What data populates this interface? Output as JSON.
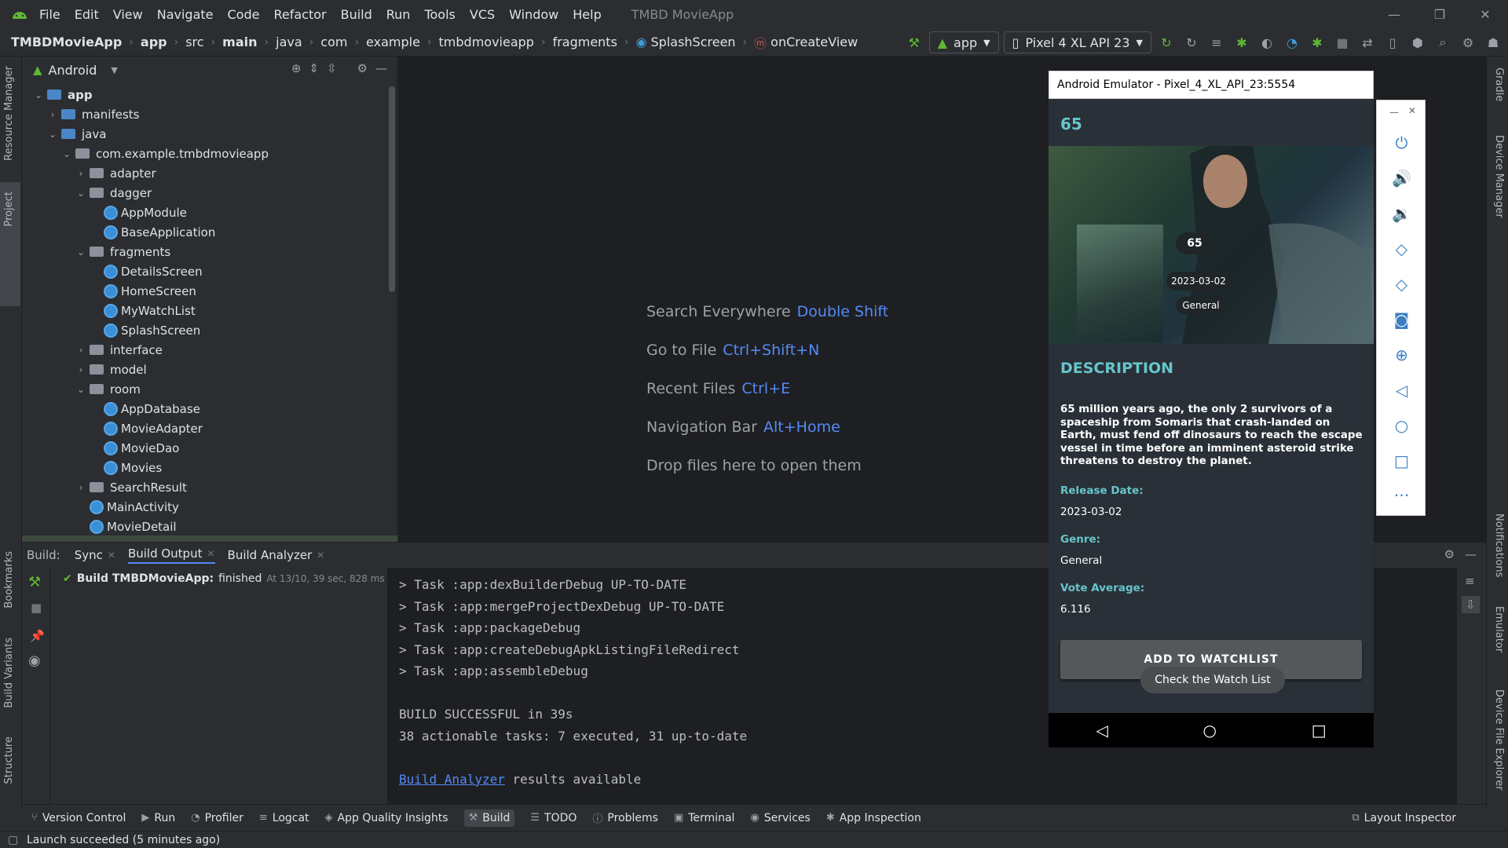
{
  "titlebar": {
    "menus": [
      "File",
      "Edit",
      "View",
      "Navigate",
      "Code",
      "Refactor",
      "Build",
      "Run",
      "Tools",
      "VCS",
      "Window",
      "Help"
    ],
    "app_title": "TMBD MovieApp",
    "controls": [
      "—",
      "❐",
      "✕"
    ]
  },
  "breadcrumb": [
    "TMBDMovieApp",
    "app",
    "src",
    "main",
    "java",
    "com",
    "example",
    "tmbdmovieapp",
    "fragments",
    "SplashScreen",
    "onCreateView"
  ],
  "toolbar": {
    "run_config": "app",
    "device": "Pixel 4 XL API 23"
  },
  "left_strip": [
    "Resource Manager",
    "Project",
    "Bookmarks",
    "Build Variants",
    "Structure"
  ],
  "right_strip": [
    "Gradle",
    "Device Manager",
    "Notifications",
    "Emulator",
    "Device File Explorer"
  ],
  "project": {
    "view_mode": "Android",
    "tree": [
      {
        "label": "app",
        "level": 0,
        "open": true,
        "type": "module"
      },
      {
        "label": "manifests",
        "level": 1,
        "open": false,
        "type": "folder-blue"
      },
      {
        "label": "java",
        "level": 1,
        "open": true,
        "type": "folder-blue"
      },
      {
        "label": "com.example.tmbdmovieapp",
        "level": 2,
        "open": true,
        "type": "folder"
      },
      {
        "label": "adapter",
        "level": 3,
        "open": false,
        "type": "folder"
      },
      {
        "label": "dagger",
        "level": 3,
        "open": true,
        "type": "folder"
      },
      {
        "label": "AppModule",
        "level": 4,
        "type": "class"
      },
      {
        "label": "BaseApplication",
        "level": 4,
        "type": "class"
      },
      {
        "label": "fragments",
        "level": 3,
        "open": true,
        "type": "folder"
      },
      {
        "label": "DetailsScreen",
        "level": 4,
        "type": "class"
      },
      {
        "label": "HomeScreen",
        "level": 4,
        "type": "class"
      },
      {
        "label": "MyWatchList",
        "level": 4,
        "type": "class"
      },
      {
        "label": "SplashScreen",
        "level": 4,
        "type": "class"
      },
      {
        "label": "interface",
        "level": 3,
        "open": false,
        "type": "folder"
      },
      {
        "label": "model",
        "level": 3,
        "open": false,
        "type": "folder"
      },
      {
        "label": "room",
        "level": 3,
        "open": true,
        "type": "folder"
      },
      {
        "label": "AppDatabase",
        "level": 4,
        "type": "class"
      },
      {
        "label": "MovieAdapter",
        "level": 4,
        "type": "class"
      },
      {
        "label": "MovieDao",
        "level": 4,
        "type": "class"
      },
      {
        "label": "Movies",
        "level": 4,
        "type": "class"
      },
      {
        "label": "SearchResult",
        "level": 3,
        "open": false,
        "type": "folder"
      },
      {
        "label": "MainActivity",
        "level": 3,
        "type": "class"
      },
      {
        "label": "MovieDetail",
        "level": 3,
        "type": "class"
      }
    ]
  },
  "editor_hints": [
    {
      "text": "Search Everywhere",
      "key": "Double Shift"
    },
    {
      "text": "Go to File",
      "key": "Ctrl+Shift+N"
    },
    {
      "text": "Recent Files",
      "key": "Ctrl+E"
    },
    {
      "text": "Navigation Bar",
      "key": "Alt+Home"
    },
    {
      "text": "Drop files here to open them",
      "key": ""
    }
  ],
  "build": {
    "label": "Build:",
    "tabs": [
      "Sync",
      "Build Output",
      "Build Analyzer"
    ],
    "active_tab": "Build Output",
    "status_title": "Build TMBDMovieApp:",
    "status_text": "finished",
    "status_time": "At 13/10, 39 sec, 828 ms",
    "console": [
      "> Task :app:dexBuilderDebug UP-TO-DATE",
      "> Task :app:mergeProjectDexDebug UP-TO-DATE",
      "> Task :app:packageDebug",
      "> Task :app:createDebugApkListingFileRedirect",
      "> Task :app:assembleDebug",
      "",
      "BUILD SUCCESSFUL in 39s",
      "38 actionable tasks: 7 executed, 31 up-to-date",
      ""
    ],
    "analyzer_link": "Build Analyzer",
    "analyzer_suffix": " results available"
  },
  "bottom_tools": [
    "Version Control",
    "Run",
    "Profiler",
    "Logcat",
    "App Quality Insights",
    "Build",
    "TODO",
    "Problems",
    "Terminal",
    "Services",
    "App Inspection"
  ],
  "bottom_active": "Build",
  "layout_inspector": "Layout Inspector",
  "status_message": "Launch succeeded (5 minutes ago)",
  "emulator": {
    "title": "Android Emulator - Pixel_4_XL_API_23:5554",
    "side_controls": [
      "power-icon",
      "volume-up-icon",
      "volume-down-icon",
      "rotate-left-icon",
      "rotate-right-icon",
      "camera-icon",
      "zoom-icon",
      "back-icon",
      "home-icon",
      "overview-icon",
      "more-icon"
    ],
    "movie_title": "65",
    "poster_chip_title": "65",
    "poster_chip_date": "2023-03-02",
    "poster_chip_genre": "General",
    "description_title": "DESCRIPTION",
    "description": "65 million years ago, the only 2 survivors of a spaceship from Somaris that crash-landed on Earth, must fend off dinosaurs to reach the escape vessel in time before an imminent asteroid strike threatens to destroy the planet.",
    "release_label": "Release Date:",
    "release_value": "2023-03-02",
    "genre_label": "Genre:",
    "genre_value": "General",
    "vote_label": "Vote Average:",
    "vote_value": "6.116",
    "watch_button": "ADD TO WATCHLIST",
    "toast": "Check the Watch List"
  },
  "colors": {
    "accent_blue": "#548af7",
    "teal": "#67c5cc",
    "success_green": "#5fb832"
  }
}
